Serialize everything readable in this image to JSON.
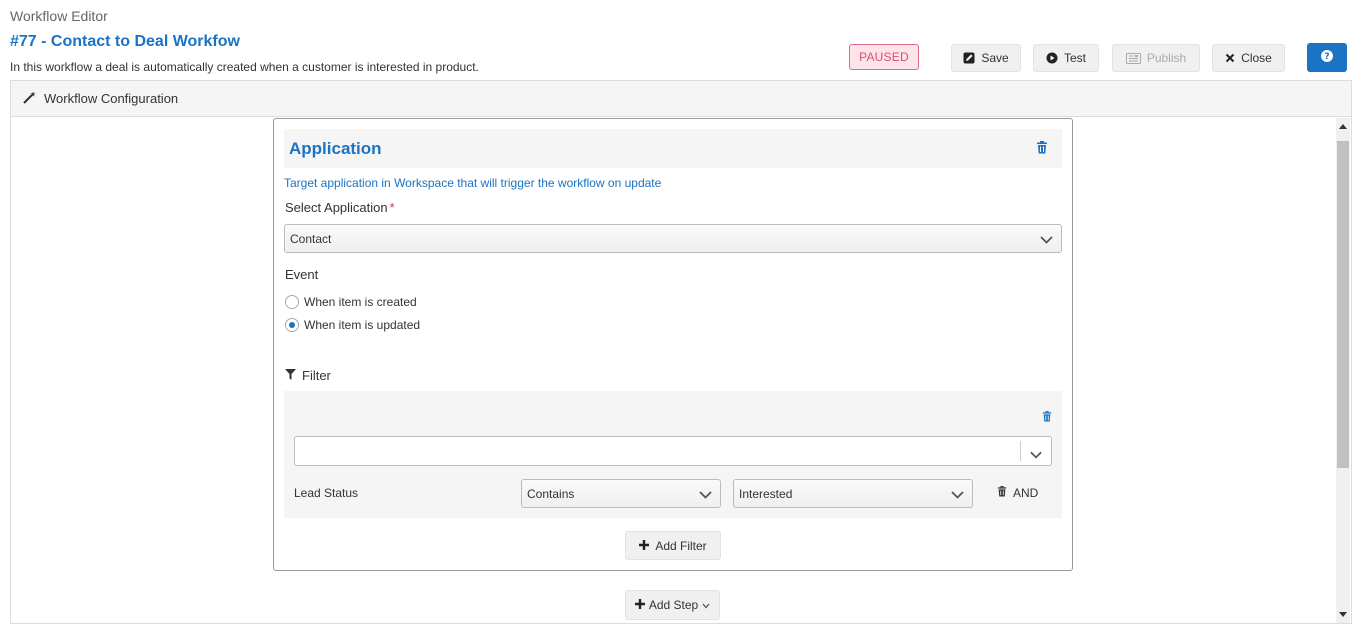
{
  "header": {
    "breadcrumb": "Workflow Editor",
    "title": "#77 - Contact to Deal Workfow",
    "description": "In this workflow a deal is automatically created when a customer is interested in product.",
    "status": "PAUSED"
  },
  "toolbar": {
    "save_label": "Save",
    "test_label": "Test",
    "publish_label": "Publish",
    "close_label": "Close"
  },
  "panel": {
    "title": "Workflow Configuration"
  },
  "step": {
    "title": "Application",
    "subtitle": "Target application in Workspace that will trigger the workflow on update",
    "select_label": "Select Application",
    "required_mark": "*",
    "selected_application": "Contact",
    "event_label": "Event",
    "event_options": [
      {
        "label": "When item is created",
        "selected": false
      },
      {
        "label": "When item is updated",
        "selected": true
      }
    ],
    "filter_label": "Filter",
    "filter": {
      "field_value": "",
      "condition_field": "Lead Status",
      "operator": "Contains",
      "value": "Interested",
      "joiner": "AND"
    },
    "add_filter_label": "Add Filter"
  },
  "add_step_label": "Add Step",
  "colors": {
    "accent": "#1a73c4",
    "status_bg": "#fde4ea",
    "status_text": "#d94f6e"
  }
}
